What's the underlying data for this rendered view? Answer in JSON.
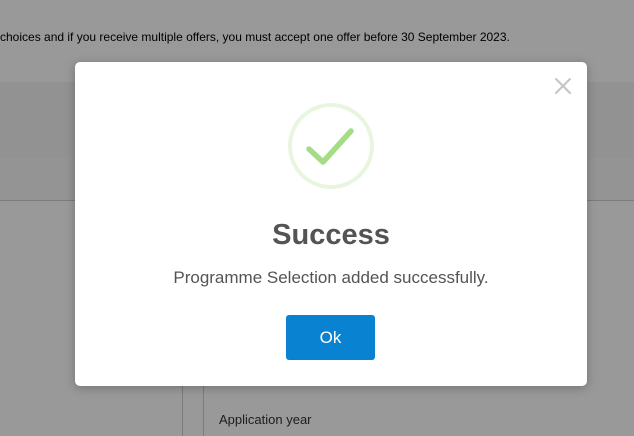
{
  "background": {
    "notice_text": "choices and if you receive multiple offers, you must accept one offer before 30 September 2023.",
    "field_label": "Application year"
  },
  "modal": {
    "icon": "check-circle-icon",
    "close_icon": "close-icon",
    "title": "Success",
    "message": "Programme Selection added successfully.",
    "ok_label": "Ok",
    "colors": {
      "success_green": "#a5dc86",
      "success_ring": "#e8f6df",
      "button_blue": "#0a82d2",
      "text_gray": "#545454"
    }
  }
}
